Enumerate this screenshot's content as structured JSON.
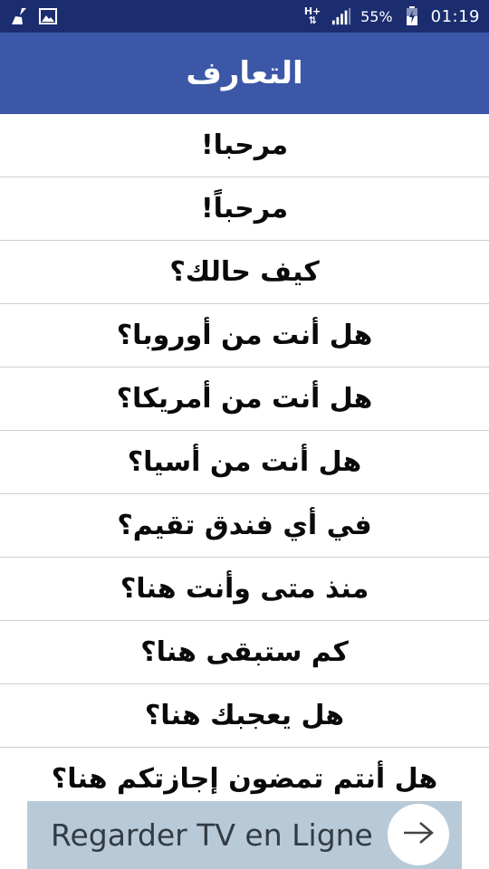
{
  "status_bar": {
    "network_type": "H+",
    "battery_percent": "55%",
    "time": "01:19",
    "icons": [
      "cleaner-broom-icon",
      "gallery-image-icon",
      "data-arrows-icon",
      "signal-icon",
      "battery-charging-icon"
    ]
  },
  "app_bar": {
    "title": "التعارف"
  },
  "phrases": [
    "مرحبا!",
    "مرحباً!",
    "كيف حالك؟",
    "هل أنت من أوروبا؟",
    "هل أنت من أمريكا؟",
    "هل أنت من أسيا؟",
    "في أي فندق تقيم؟",
    "منذ متى وأنت هنا؟",
    "كم ستبقى هنا؟",
    "هل يعجبك هنا؟",
    "هل أنتم تمضون إجازتكم هنا؟"
  ],
  "ad": {
    "text": "Regarder TV en Ligne",
    "icon": "arrow-right-icon",
    "background": "#b8cad8"
  },
  "colors": {
    "status_bar": "#1b2d6f",
    "app_bar": "#3c57a7",
    "divider": "#cfcfcf"
  }
}
